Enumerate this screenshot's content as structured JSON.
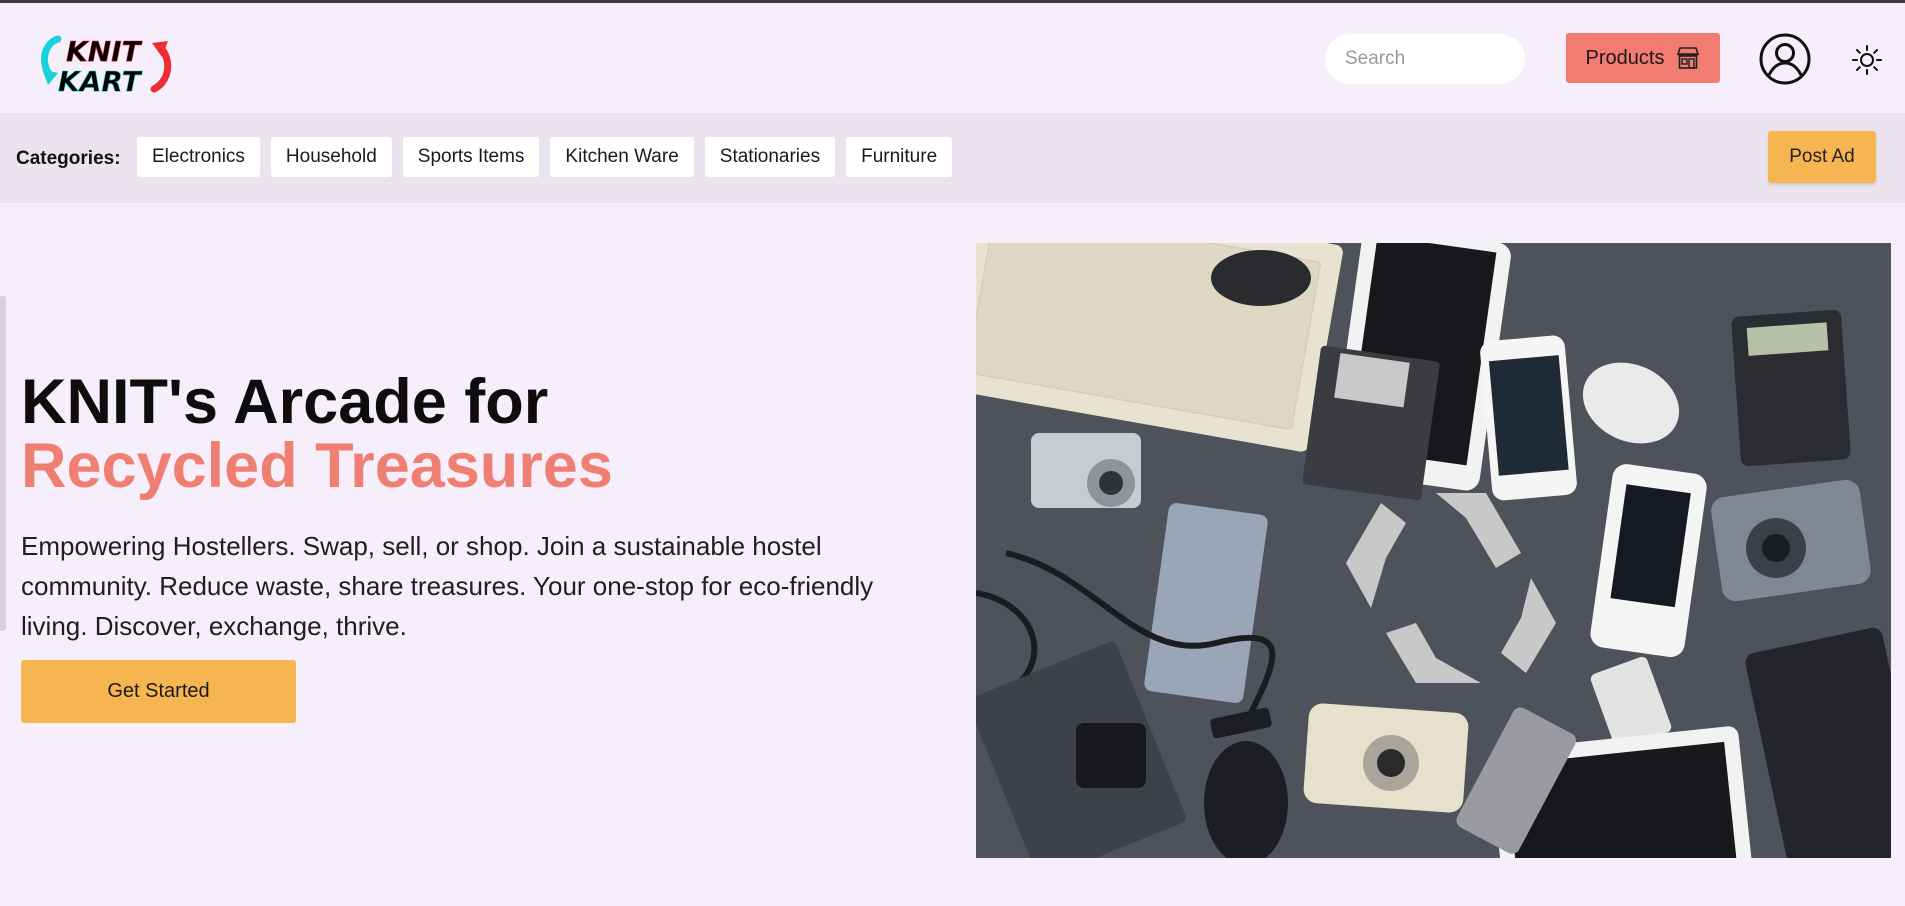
{
  "header": {
    "logo_line1": "KNIT",
    "logo_line2": "KART",
    "search": {
      "placeholder": "Search",
      "icon": "search-icon"
    },
    "products_label": "Products",
    "products_icon": "store-icon",
    "profile_icon": "user-circle-icon",
    "theme_icon": "sun-icon"
  },
  "categories": {
    "label": "Categories:",
    "items": [
      "Electronics",
      "Household",
      "Sports Items",
      "Kitchen Ware",
      "Stationaries",
      "Furniture"
    ],
    "post_ad_label": "Post Ad"
  },
  "hero": {
    "title_line1": "KNIT's Arcade for",
    "title_line2": "Recycled Treasures",
    "description": "Empowering Hostellers. Swap, sell, or shop. Join a sustainable hostel community. Reduce waste, share treasures. Your one-stop for eco-friendly living. Discover, exchange, thrive.",
    "cta_label": "Get Started"
  },
  "colors": {
    "background": "#f6eefb",
    "category_bar": "#ebe4ef",
    "accent_salmon": "#f07f73",
    "accent_yellow": "#f7b551",
    "products_button": "#f27b72"
  }
}
